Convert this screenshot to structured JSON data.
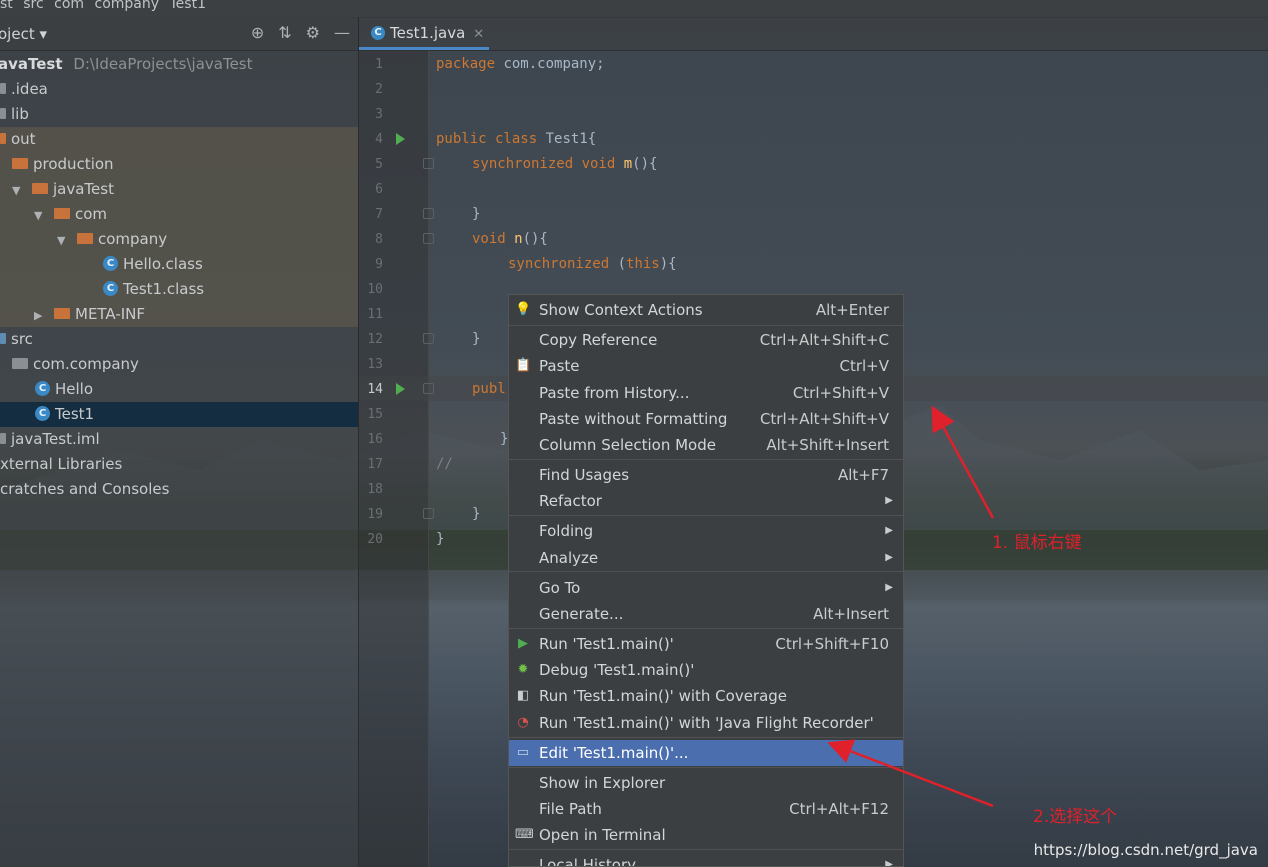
{
  "breadcrumb": [
    "st",
    "src",
    "com",
    "company",
    "Test1"
  ],
  "project_panel": {
    "title": "oject",
    "tree": [
      {
        "label": "avaTest",
        "path": "D:\\IdeaProjects\\javaTest",
        "icon": "module-folder-icon"
      },
      {
        "label": ".idea",
        "icon": "folder-icon"
      },
      {
        "label": "lib",
        "icon": "folder-icon"
      },
      {
        "label": "out",
        "icon": "folder-icon"
      },
      {
        "label": "production",
        "icon": "folder-icon"
      },
      {
        "label": "javaTest",
        "icon": "folder-icon"
      },
      {
        "label": "com",
        "icon": "folder-icon"
      },
      {
        "label": "company",
        "icon": "folder-icon"
      },
      {
        "label": "Hello.class",
        "icon": "class-icon"
      },
      {
        "label": "Test1.class",
        "icon": "class-icon"
      },
      {
        "label": "META-INF",
        "icon": "folder-icon"
      },
      {
        "label": "src",
        "icon": "source-folder-icon"
      },
      {
        "label": "com.company",
        "icon": "package-icon"
      },
      {
        "label": "Hello",
        "icon": "class-icon"
      },
      {
        "label": "Test1",
        "icon": "class-icon"
      },
      {
        "label": "javaTest.iml",
        "icon": "iml-file-icon"
      },
      {
        "label": "xternal Libraries",
        "icon": "library-icon"
      },
      {
        "label": "cratches and Consoles",
        "icon": "scratch-icon"
      }
    ]
  },
  "editor": {
    "tab": "Test1.java",
    "line_numbers": [
      "1",
      "2",
      "3",
      "4",
      "5",
      "6",
      "7",
      "8",
      "9",
      "10",
      "11",
      "12",
      "13",
      "14",
      "15",
      "16",
      "17",
      "18",
      "19",
      "20"
    ],
    "lines": {
      "l1_kw": "package",
      "l1_rest": " com.company;",
      "l4_kw": "public class",
      "l4_rest": " Test1{",
      "l5_kw": "synchronized void",
      "l5_fn": " m",
      "l5_rest": "(){",
      "l7": "}",
      "l8_kw": "void",
      "l8_fn": " n",
      "l8_rest": "(){",
      "l9_kw": "synchronized",
      "l9_mid": " (",
      "l9_kw2": "this",
      "l9_rest": "){",
      "l12": "}",
      "l14_kw": "publ",
      "l16": "}",
      "l17": "//",
      "l19": "}",
      "l20": "}"
    }
  },
  "context_menu": {
    "items": [
      {
        "label": "Show Context Actions",
        "shortcut": "Alt+Enter",
        "icon": "bulb-icon"
      },
      {
        "label": "Copy Reference",
        "shortcut": "Ctrl+Alt+Shift+C"
      },
      {
        "label": "Paste",
        "shortcut": "Ctrl+V",
        "icon": "clipboard-icon"
      },
      {
        "label": "Paste from History...",
        "shortcut": "Ctrl+Shift+V"
      },
      {
        "label": "Paste without Formatting",
        "shortcut": "Ctrl+Alt+Shift+V"
      },
      {
        "label": "Column Selection Mode",
        "shortcut": "Alt+Shift+Insert"
      },
      {
        "label": "Find Usages",
        "shortcut": "Alt+F7"
      },
      {
        "label": "Refactor",
        "submenu": "▶"
      },
      {
        "label": "Folding",
        "submenu": "▶"
      },
      {
        "label": "Analyze",
        "submenu": "▶"
      },
      {
        "label": "Go To",
        "submenu": "▶"
      },
      {
        "label": "Generate...",
        "shortcut": "Alt+Insert"
      },
      {
        "label": "Run 'Test1.main()'",
        "shortcut": "Ctrl+Shift+F10",
        "icon": "run-icon"
      },
      {
        "label": "Debug 'Test1.main()'",
        "icon": "debug-icon"
      },
      {
        "label": "Run 'Test1.main()' with Coverage",
        "icon": "coverage-icon"
      },
      {
        "label": "Run 'Test1.main()' with 'Java Flight Recorder'",
        "icon": "flight-recorder-icon"
      },
      {
        "label": "Edit 'Test1.main()'...",
        "icon": "edit-config-icon"
      },
      {
        "label": "Show in Explorer"
      },
      {
        "label": "File Path",
        "shortcut": "Ctrl+Alt+F12"
      },
      {
        "label": "Open in Terminal",
        "icon": "terminal-icon"
      },
      {
        "label": "Local History",
        "submenu": "▶"
      }
    ]
  },
  "annotations": {
    "step1": "1. 鼠标右键",
    "step2": "2.选择这个"
  },
  "watermark": "https://blog.csdn.net/grd_java",
  "colors": {
    "menu_selected": "#4b6eaf",
    "annotation": "#e0202a",
    "keyword": "#cc7832",
    "function": "#ffc66d"
  }
}
